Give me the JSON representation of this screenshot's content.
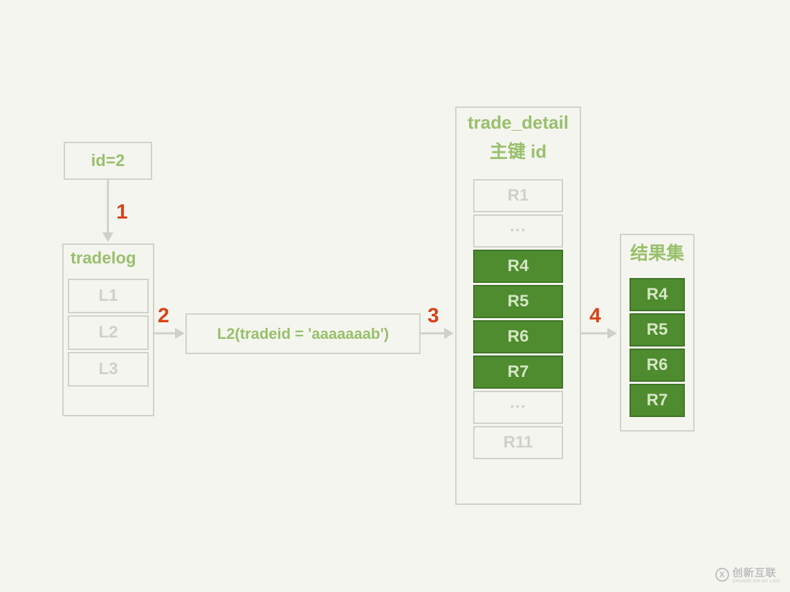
{
  "boxes": {
    "id_box": "id=2",
    "tradelog": {
      "title": "tradelog",
      "rows": [
        "L1",
        "L2",
        "L3"
      ]
    },
    "condition": "L2(tradeid = 'aaaaaaab')",
    "trade_detail": {
      "title_line1": "trade_detail",
      "title_line2": "主键 id",
      "rows": [
        {
          "label": "R1",
          "type": "white"
        },
        {
          "label": "···",
          "type": "white"
        },
        {
          "label": "R4",
          "type": "green"
        },
        {
          "label": "R5",
          "type": "green"
        },
        {
          "label": "R6",
          "type": "green"
        },
        {
          "label": "R7",
          "type": "green"
        },
        {
          "label": "···",
          "type": "white"
        },
        {
          "label": "R11",
          "type": "white"
        }
      ]
    },
    "result": {
      "title": "结果集",
      "rows": [
        "R4",
        "R5",
        "R6",
        "R7"
      ]
    }
  },
  "steps": [
    "1",
    "2",
    "3",
    "4"
  ],
  "watermark": {
    "icon": "X",
    "text": "创新互联",
    "sub": "CHUANG XIN HU LIAN"
  }
}
